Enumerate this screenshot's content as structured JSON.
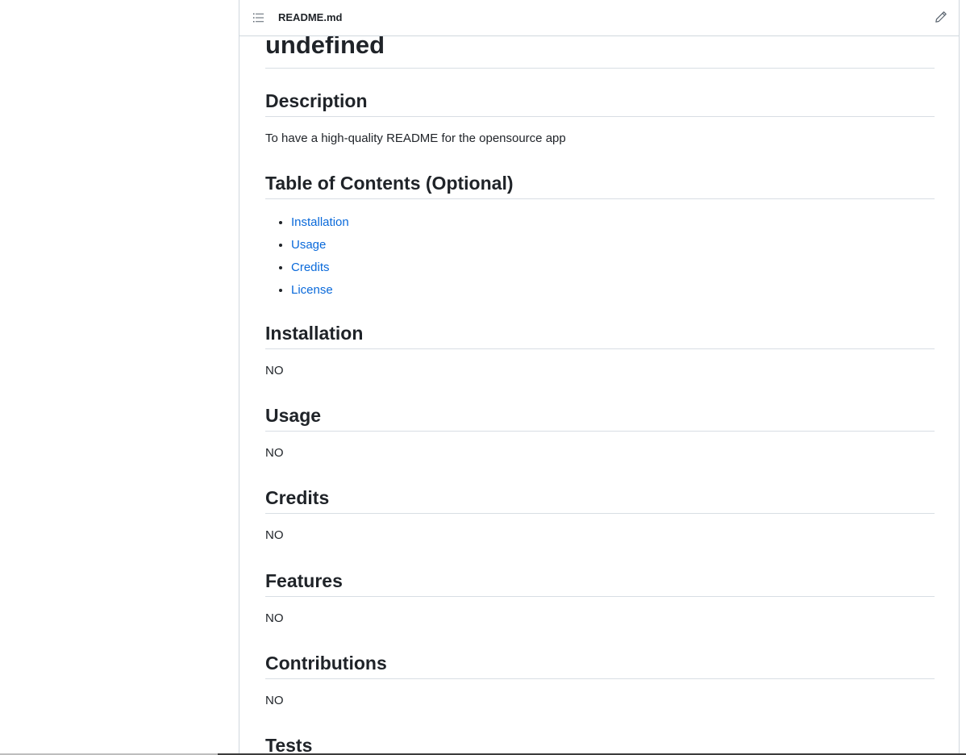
{
  "header": {
    "file_name": "README.md",
    "toc_icon": "list-unordered-icon",
    "edit_icon": "pencil-icon"
  },
  "readme": {
    "title": "undefined",
    "description": {
      "heading": "Description",
      "text": "To have a high-quality README for the opensource app"
    },
    "toc": {
      "heading": "Table of Contents (Optional)",
      "items": [
        "Installation",
        "Usage",
        "Credits",
        "License"
      ]
    },
    "installation": {
      "heading": "Installation",
      "text": "NO"
    },
    "usage": {
      "heading": "Usage",
      "text": "NO"
    },
    "credits": {
      "heading": "Credits",
      "text": "NO"
    },
    "features": {
      "heading": "Features",
      "text": "NO"
    },
    "contributions": {
      "heading": "Contributions",
      "text": "NO"
    },
    "tests": {
      "heading": "Tests"
    }
  },
  "colors": {
    "link": "#0969da",
    "text": "#1f2328",
    "border": "#d0d7de"
  }
}
